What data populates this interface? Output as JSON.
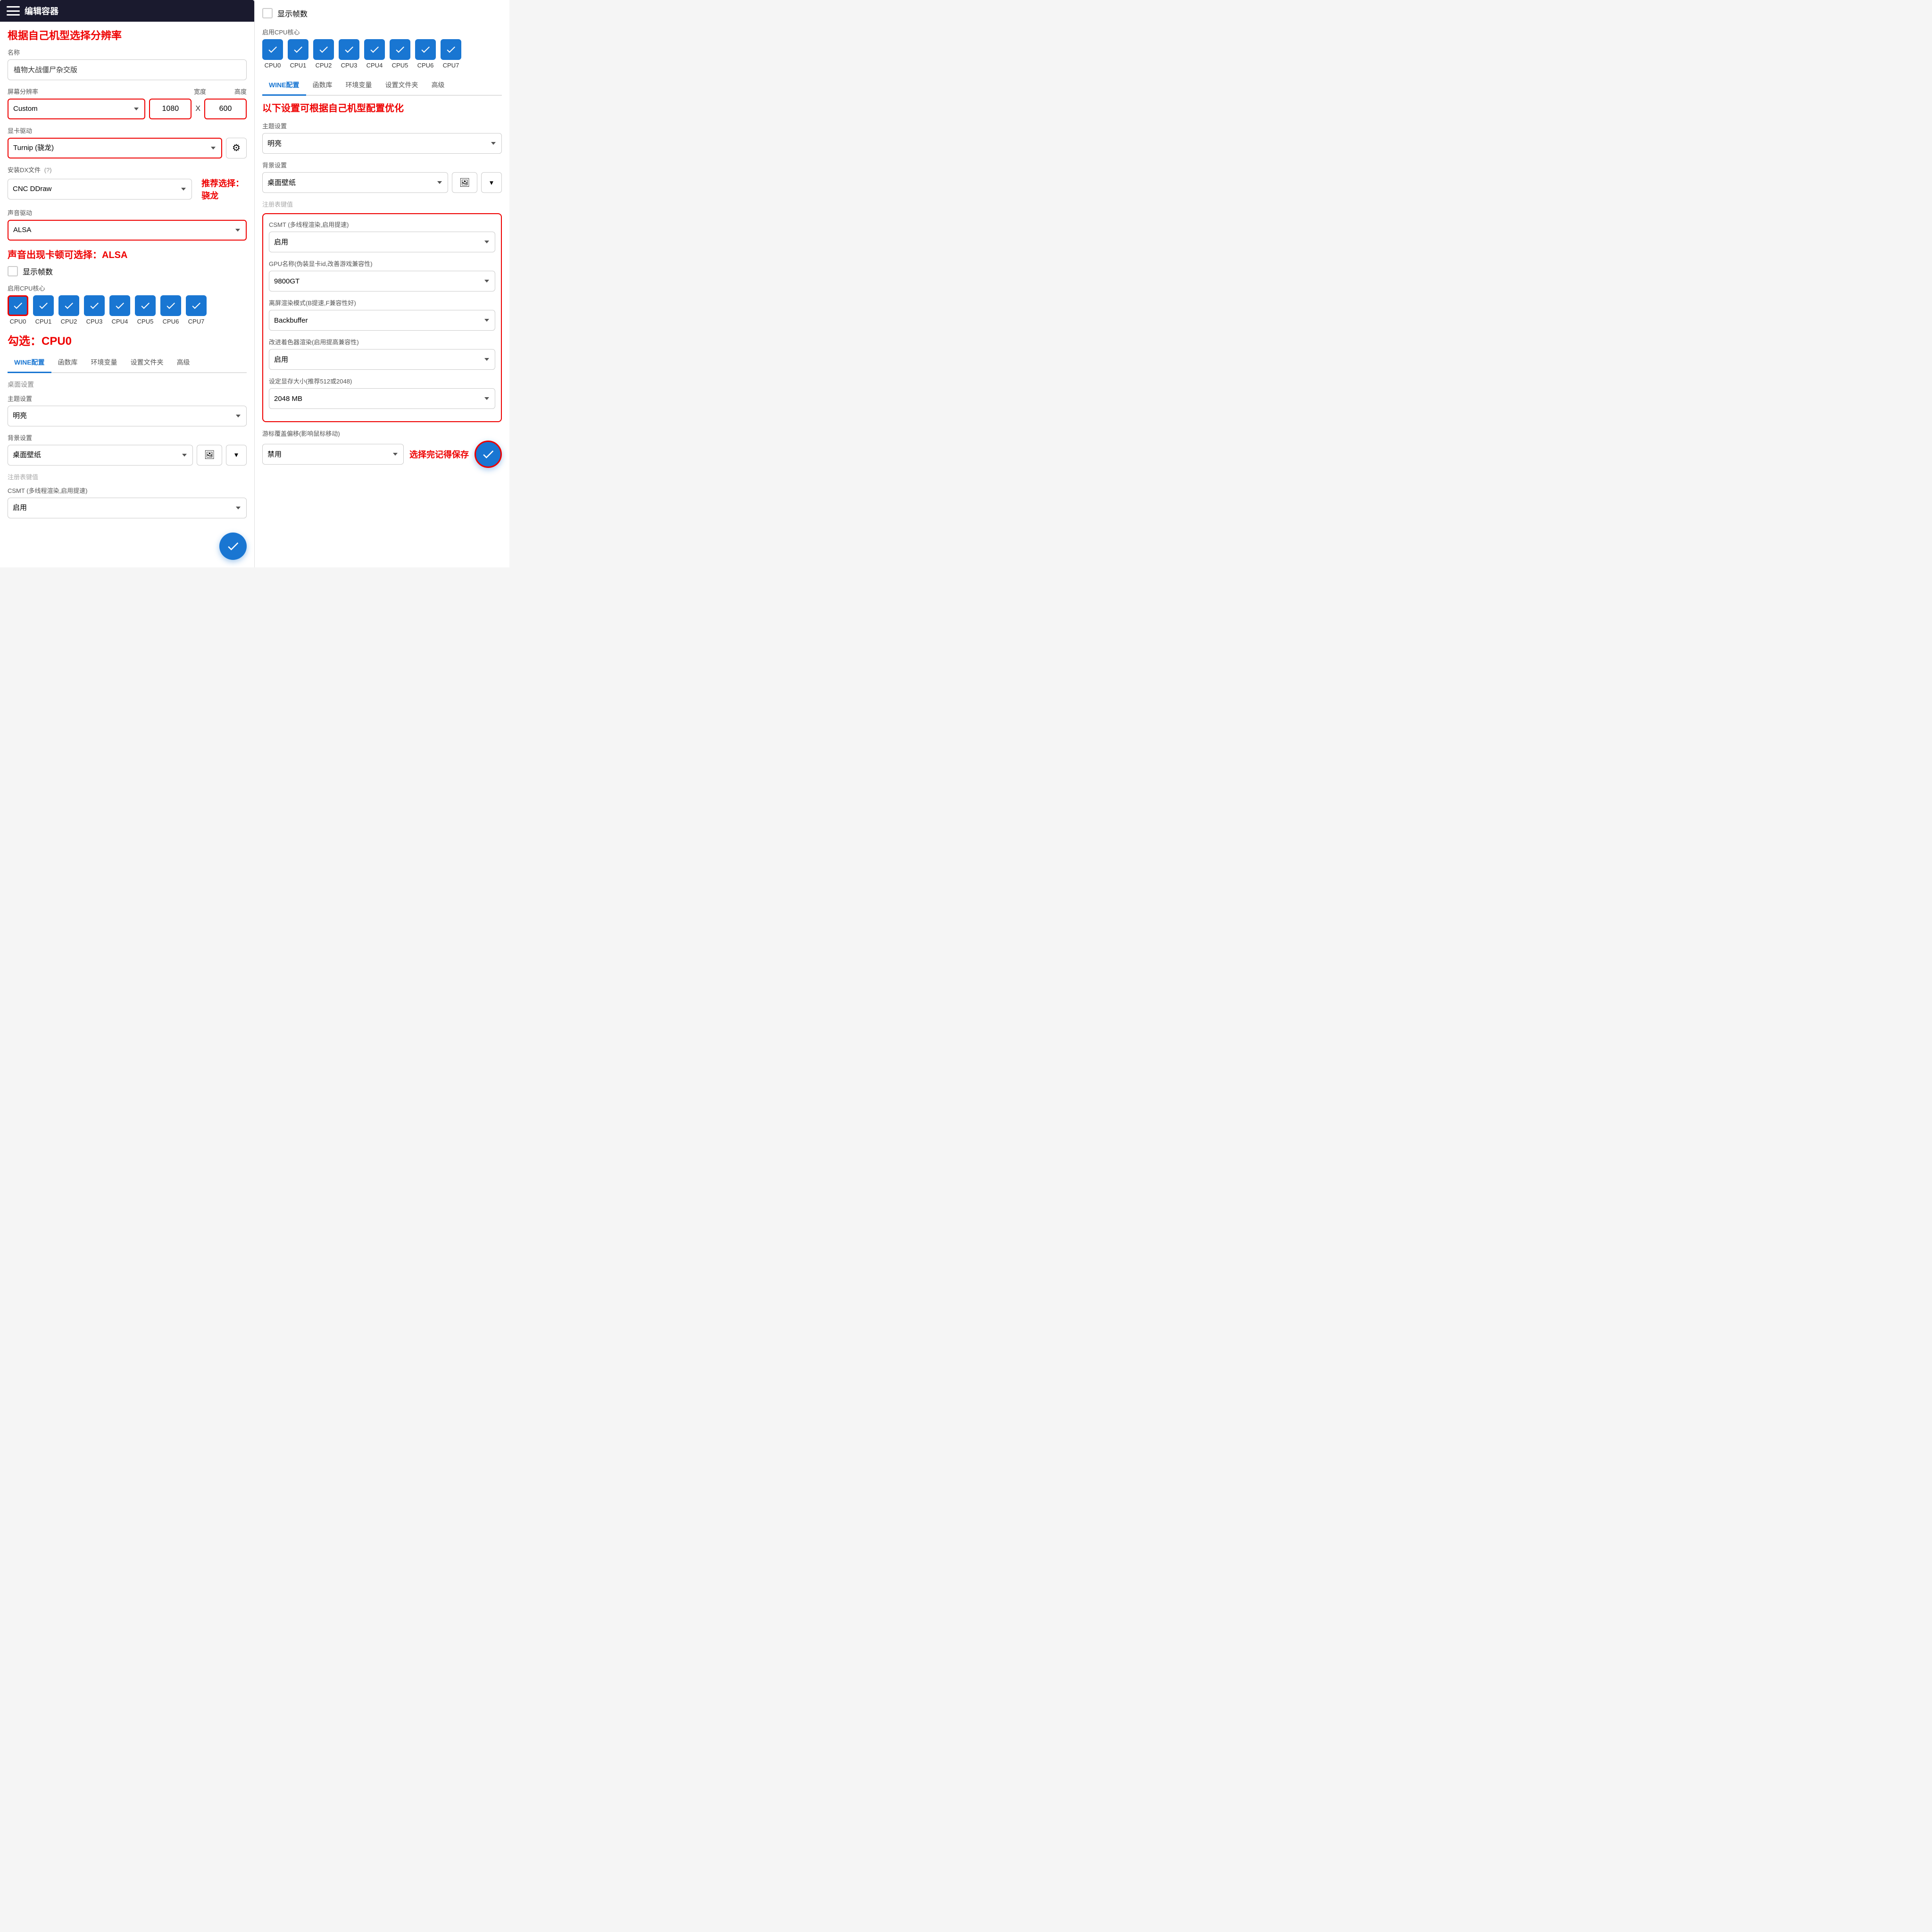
{
  "header": {
    "title": "编辑容器"
  },
  "left": {
    "annotation_top": "根据自己机型选择分辨率",
    "name_label": "名称",
    "name_value": "植物大战僵尸杂交版",
    "resolution_label": "屏幕分辨率",
    "width_label": "宽度",
    "height_label": "高度",
    "resolution_value": "Custom",
    "width_value": "1080",
    "height_value": "600",
    "gpu_label": "显卡驱动",
    "gpu_value": "Turnip (骁龙)",
    "dx_label": "安装DX文件",
    "dx_value": "CNC DDraw",
    "dx_annotation": "推荐选择：骁龙",
    "sound_label": "声音驱动",
    "sound_value": "ALSA",
    "sound_annotation": "声音出现卡顿可选择：ALSA",
    "show_fps_label": "显示帧数",
    "cpu_label": "启用CPU核心",
    "cpu_annotation": "勾选：CPU0",
    "cpu_items": [
      {
        "id": "CPU0",
        "checked": true
      },
      {
        "id": "CPU1",
        "checked": true
      },
      {
        "id": "CPU2",
        "checked": true
      },
      {
        "id": "CPU3",
        "checked": true
      },
      {
        "id": "CPU4",
        "checked": true
      },
      {
        "id": "CPU5",
        "checked": true
      },
      {
        "id": "CPU6",
        "checked": true
      },
      {
        "id": "CPU7",
        "checked": true
      }
    ],
    "tabs": [
      "WINE配置",
      "函数库",
      "环境变量",
      "设置文件夹",
      "高级"
    ],
    "active_tab": "WINE配置",
    "desktop_label": "桌面设置",
    "theme_label": "主题设置",
    "theme_value": "明亮",
    "bg_label": "背景设置",
    "bg_value": "桌面壁纸",
    "reg_label": "注册表键值",
    "csmt_label": "CSMT (多线程渲染,启用提速)",
    "csmt_value": "启用",
    "partial_cut": true
  },
  "right": {
    "annotation_top": "以下设置可根据自己机型配置优化",
    "show_fps_label": "显示帧数",
    "cpu_label": "启用CPU核心",
    "cpu_items": [
      {
        "id": "CPU0",
        "checked": true
      },
      {
        "id": "CPU1",
        "checked": true
      },
      {
        "id": "CPU2",
        "checked": true
      },
      {
        "id": "CPU3",
        "checked": true
      },
      {
        "id": "CPU4",
        "checked": true
      },
      {
        "id": "CPU5",
        "checked": true
      },
      {
        "id": "CPU6",
        "checked": true
      },
      {
        "id": "CPU7",
        "checked": true
      }
    ],
    "tabs": [
      "WINE配置",
      "函数库",
      "环境变量",
      "设置文件夹",
      "高级"
    ],
    "active_tab": "WINE配置",
    "theme_label": "主题设置",
    "theme_value": "明亮",
    "bg_label": "背景设置",
    "bg_value": "桌面壁纸",
    "reg_label": "注册表键值",
    "csmt_section_label": "CSMT (多线程渲染,启用提速)",
    "csmt_value": "启用",
    "gpu_name_label": "GPU名称(伪装显卡id,改善游戏兼容性)",
    "gpu_name_value": "9800GT",
    "offscreen_label": "离屏渲染模式(B提速,F兼容性好)",
    "offscreen_value": "Backbuffer",
    "shader_label": "改进着色器渲染(启用提高兼容性)",
    "shader_value": "启用",
    "vram_label": "设定显存大小(推荐512或2048)",
    "vram_value": "2048 MB",
    "cursor_label": "游标覆盖偏移(影响鼠标移动)",
    "cursor_value": "禁用",
    "cursor_annotation": "选择完记得保存",
    "save_label": "✓"
  },
  "icons": {
    "hamburger": "☰",
    "gear": "⚙",
    "checkmark": "✓",
    "image": "🖼",
    "chevron_down": "▼"
  }
}
